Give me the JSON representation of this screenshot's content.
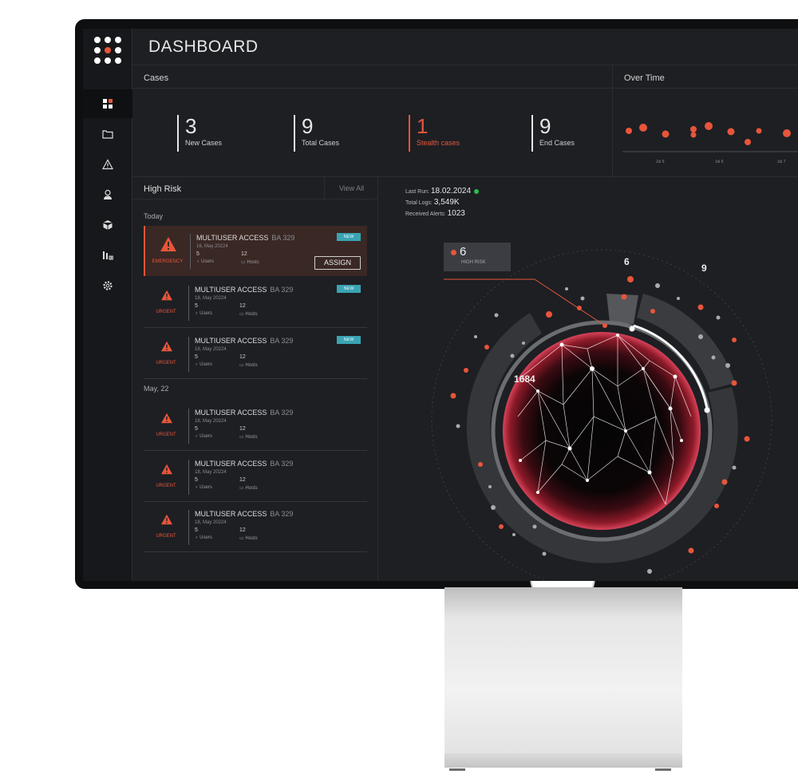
{
  "app": {
    "title": "DASHBOARD"
  },
  "sidebar": {
    "items": [
      {
        "icon": "dashboard-icon"
      },
      {
        "icon": "folder-icon"
      },
      {
        "icon": "alert-triangle-icon"
      },
      {
        "icon": "user-icon"
      },
      {
        "icon": "cube-icon"
      },
      {
        "icon": "bar-chart-icon"
      },
      {
        "icon": "gear-icon"
      }
    ]
  },
  "cases": {
    "title": "Cases",
    "stats": [
      {
        "value": "3",
        "label": "New Cases"
      },
      {
        "value": "9",
        "label": "Total Cases"
      },
      {
        "value": "1",
        "label": "Stealth cases"
      },
      {
        "value": "9",
        "label": "End Cases"
      }
    ]
  },
  "over_time": {
    "title": "Over Time",
    "ticks": [
      "Jul 5",
      "Jul 6",
      "Jul 7"
    ]
  },
  "high_risk": {
    "title": "High Risk",
    "view_all": "View All",
    "groups": [
      {
        "label": "Today",
        "cards": [
          {
            "level": "EMERGENCY",
            "name": "MULTIUSER ACCESS",
            "code": "BA 329",
            "date": "16, May 20224",
            "users": "5",
            "users_label": "Users",
            "hosts": "12",
            "hosts_label": "Hosts",
            "badge": "NEW",
            "action": "ASSIGN"
          },
          {
            "level": "URGENT",
            "name": "MULTIUSER ACCESS",
            "code": "BA 329",
            "date": "18, May 20224",
            "users": "5",
            "users_label": "Users",
            "hosts": "12",
            "hosts_label": "Hosts",
            "badge": "NEW"
          },
          {
            "level": "URGENT",
            "name": "MULTIUSER ACCESS",
            "code": "BA 329",
            "date": "18, May 20224",
            "users": "5",
            "users_label": "Users",
            "hosts": "12",
            "hosts_label": "Hosts",
            "badge": "NEW"
          }
        ]
      },
      {
        "label": "May, 22",
        "cards": [
          {
            "level": "URGENT",
            "name": "MULTIUSER ACCESS",
            "code": "BA 329",
            "date": "18, May 20224",
            "users": "5",
            "users_label": "Users",
            "hosts": "12",
            "hosts_label": "Hosts"
          },
          {
            "level": "URGENT",
            "name": "MULTIUSER ACCESS",
            "code": "BA 329",
            "date": "18, May 20224",
            "users": "5",
            "users_label": "Users",
            "hosts": "12",
            "hosts_label": "Hosts"
          },
          {
            "level": "URGENT",
            "name": "MULTIUSER ACCESS",
            "code": "BA 329",
            "date": "18, May 20224",
            "users": "5",
            "users_label": "Users",
            "hosts": "12",
            "hosts_label": "Hosts"
          }
        ]
      }
    ]
  },
  "run_info": {
    "last_run_label": "Last Run:",
    "last_run": "18.02.2024",
    "logs_label": "Total Logs:",
    "logs": "3,549K",
    "alerts_label": "Received Alerts:",
    "alerts": "1023"
  },
  "viz": {
    "high_risk_count": "6",
    "high_risk_label": "HIGH RISK",
    "numbers": [
      "6",
      "9",
      "1684"
    ]
  },
  "colors": {
    "accent": "#e8553a",
    "badge": "#3aa4b3",
    "status_ok": "#2dbb4a",
    "background": "#1d1f23"
  }
}
